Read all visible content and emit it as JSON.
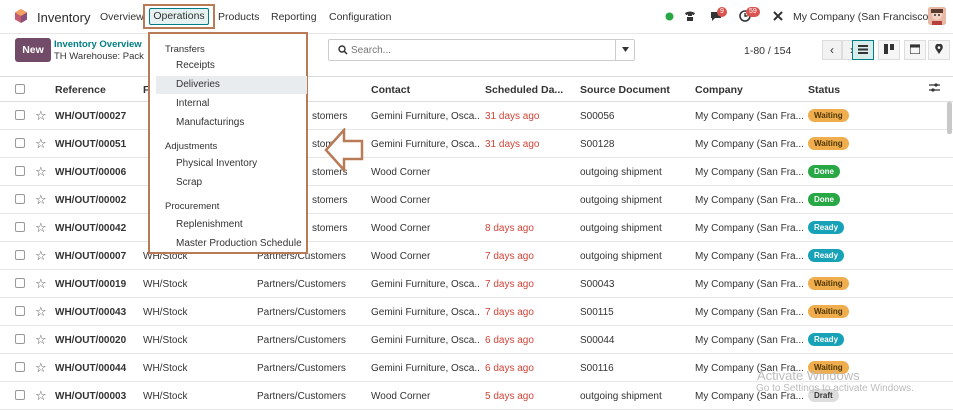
{
  "app": {
    "name": "Inventory"
  },
  "menu": {
    "overview": "Overview",
    "operations": "Operations",
    "products": "Products",
    "reporting": "Reporting",
    "configuration": "Configuration"
  },
  "systray": {
    "messages_count": "9",
    "activity_count": "59",
    "company": "My Company (San Francisco)"
  },
  "control": {
    "new_label": "New",
    "breadcrumb_title": "Inventory Overview",
    "breadcrumb_sub": "TH Warehouse: Pack",
    "search_placeholder": "Search...",
    "pager": "1-80 / 154"
  },
  "table": {
    "headers": {
      "reference": "Reference",
      "from": "F",
      "contact": "Contact",
      "scheduled": "Scheduled Da...",
      "source": "Source Document",
      "company": "Company",
      "status": "Status"
    },
    "rows": [
      {
        "ref": "WH/OUT/00027",
        "from": "",
        "to": "stomers",
        "contact": "Gemini Furniture, Osca...",
        "scheduled": "31 days ago",
        "source": "S00056",
        "company": "My Company (San Fra...",
        "status": "Waiting",
        "status_kind": "waiting"
      },
      {
        "ref": "WH/OUT/00051",
        "from": "",
        "to": "stomers",
        "contact": "Gemini Furniture, Osca...",
        "scheduled": "31 days ago",
        "source": "S00128",
        "company": "My Company (San Fra...",
        "status": "Waiting",
        "status_kind": "waiting"
      },
      {
        "ref": "WH/OUT/00006",
        "from": "",
        "to": "stomers",
        "contact": "Wood Corner",
        "scheduled": "",
        "source": "outgoing shipment",
        "company": "My Company (San Fra...",
        "status": "Done",
        "status_kind": "done"
      },
      {
        "ref": "WH/OUT/00002",
        "from": "",
        "to": "stomers",
        "contact": "Wood Corner",
        "scheduled": "",
        "source": "outgoing shipment",
        "company": "My Company (San Fra...",
        "status": "Done",
        "status_kind": "done"
      },
      {
        "ref": "WH/OUT/00042",
        "from": "",
        "to": "stomers",
        "contact": "Wood Corner",
        "scheduled": "8 days ago",
        "source": "outgoing shipment",
        "company": "My Company (San Fra...",
        "status": "Ready",
        "status_kind": "ready"
      },
      {
        "ref": "WH/OUT/00007",
        "from": "WH/Stock",
        "to": "Partners/Customers",
        "contact": "Wood Corner",
        "scheduled": "7 days ago",
        "source": "outgoing shipment",
        "company": "My Company (San Fra...",
        "status": "Ready",
        "status_kind": "ready"
      },
      {
        "ref": "WH/OUT/00019",
        "from": "WH/Stock",
        "to": "Partners/Customers",
        "contact": "Gemini Furniture, Osca...",
        "scheduled": "7 days ago",
        "source": "S00043",
        "company": "My Company (San Fra...",
        "status": "Waiting",
        "status_kind": "waiting"
      },
      {
        "ref": "WH/OUT/00043",
        "from": "WH/Stock",
        "to": "Partners/Customers",
        "contact": "Gemini Furniture, Osca...",
        "scheduled": "7 days ago",
        "source": "S00115",
        "company": "My Company (San Fra...",
        "status": "Waiting",
        "status_kind": "waiting"
      },
      {
        "ref": "WH/OUT/00020",
        "from": "WH/Stock",
        "to": "Partners/Customers",
        "contact": "Gemini Furniture, Osca...",
        "scheduled": "6 days ago",
        "source": "S00044",
        "company": "My Company (San Fra...",
        "status": "Ready",
        "status_kind": "ready"
      },
      {
        "ref": "WH/OUT/00044",
        "from": "WH/Stock",
        "to": "Partners/Customers",
        "contact": "Gemini Furniture, Osca...",
        "scheduled": "6 days ago",
        "source": "S00116",
        "company": "My Company (San Fra...",
        "status": "Waiting",
        "status_kind": "waiting"
      },
      {
        "ref": "WH/OUT/00003",
        "from": "WH/Stock",
        "to": "Partners/Customers",
        "contact": "Wood Corner",
        "scheduled": "5 days ago",
        "source": "outgoing shipment",
        "company": "My Company (San Fra...",
        "status": "Draft",
        "status_kind": "draft"
      }
    ]
  },
  "dropdown": {
    "sections": [
      {
        "title": "Transfers",
        "items": [
          "Receipts",
          "Deliveries",
          "Internal",
          "Manufacturings"
        ]
      },
      {
        "title": "Adjustments",
        "items": [
          "Physical Inventory",
          "Scrap"
        ]
      },
      {
        "title": "Procurement",
        "items": [
          "Replenishment",
          "Master Production Schedule"
        ]
      }
    ],
    "active_item": "Deliveries"
  },
  "watermark": {
    "line1": "Activate Windows",
    "line2": "Go to Settings to activate Windows."
  },
  "colors": {
    "accent": "#017e84",
    "brand": "#714b67",
    "highlight_box": "#b97a57",
    "late": "#d04437"
  }
}
